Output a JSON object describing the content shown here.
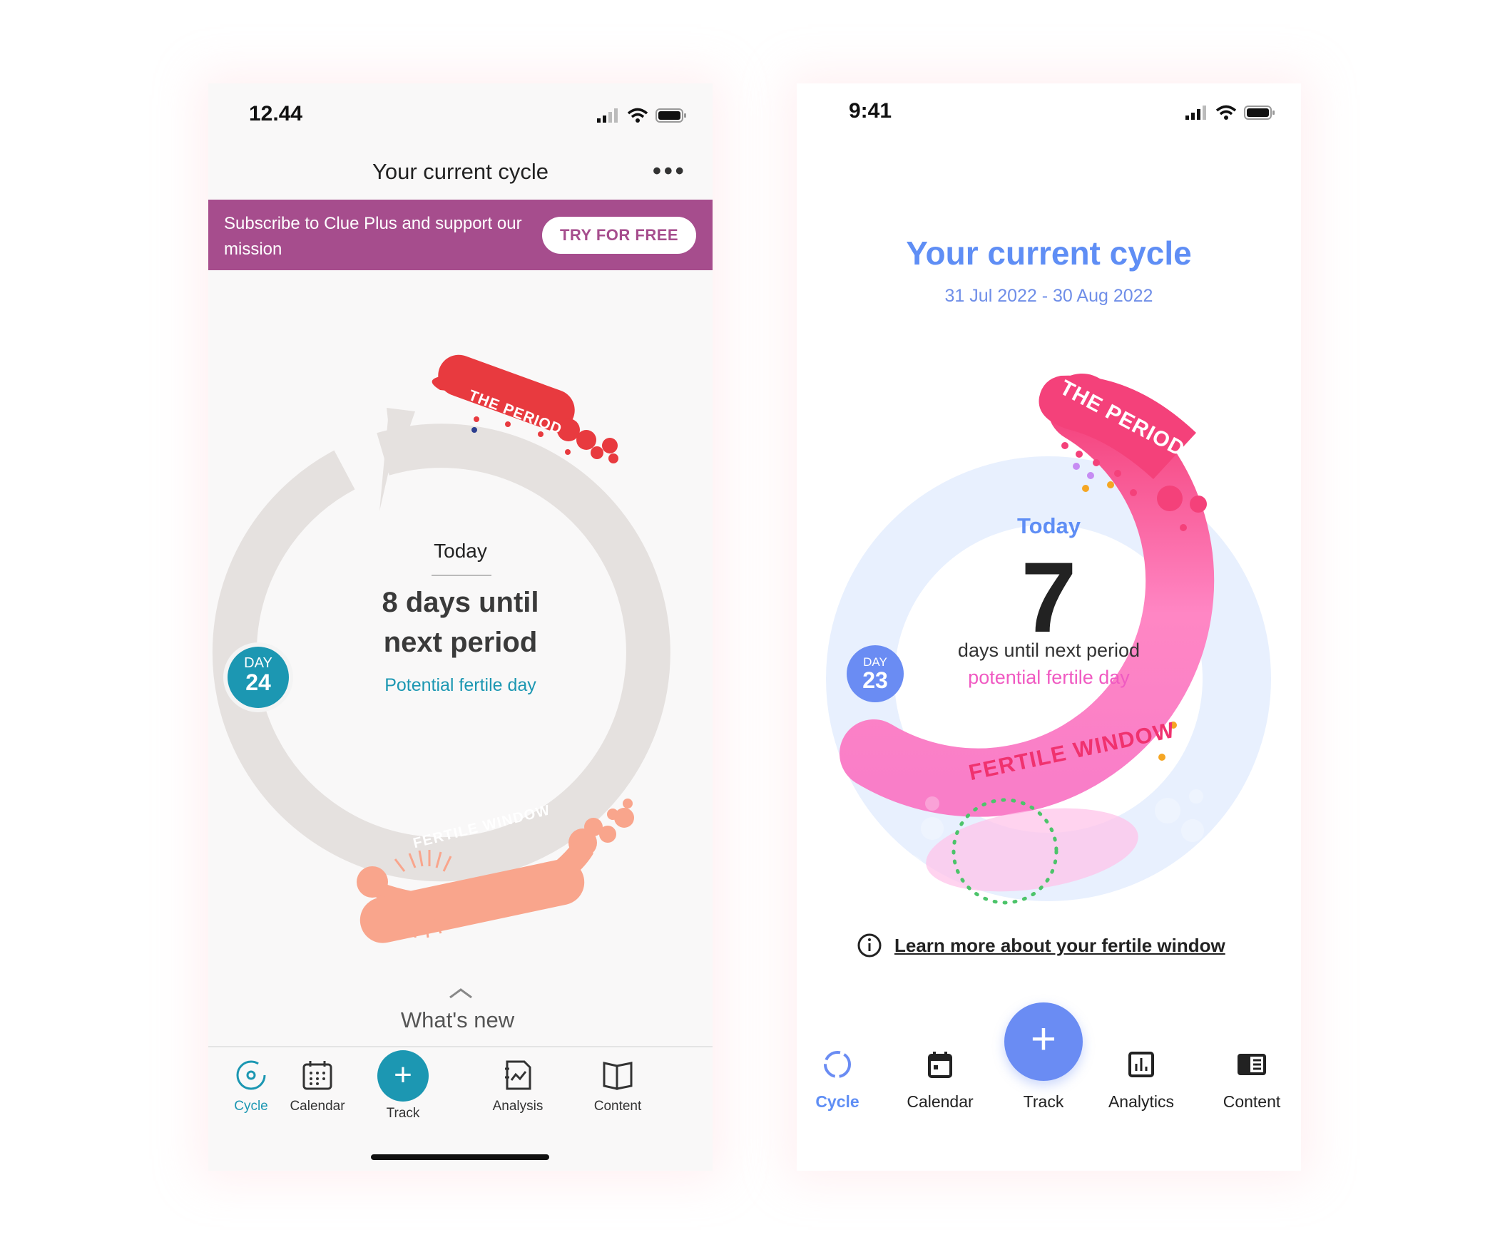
{
  "left_phone": {
    "status": {
      "time": "12.44"
    },
    "header": {
      "title": "Your current cycle",
      "more": "•••"
    },
    "banner": {
      "text": "Subscribe to Clue Plus and support our mission",
      "button": "TRY FOR FREE"
    },
    "ring": {
      "period_label": "THE PERIOD",
      "fertile_label": "FERTILE WINDOW",
      "day_label": "DAY",
      "day_number": "24"
    },
    "center": {
      "today": "Today",
      "main_line1": "8 days until",
      "main_line2": "next period",
      "fertile": "Potential fertile day"
    },
    "whats_new": "What's new",
    "nav": [
      {
        "label": "Cycle",
        "icon": "cycle-icon"
      },
      {
        "label": "Calendar",
        "icon": "calendar-icon"
      },
      {
        "label": "Track",
        "icon": "plus-icon"
      },
      {
        "label": "Analysis",
        "icon": "analysis-icon"
      },
      {
        "label": "Content",
        "icon": "book-icon"
      }
    ],
    "colors": {
      "accent": "#1c97b2",
      "banner": "#a64d8d",
      "period": "#e83a3f",
      "fertile": "#f9a58c"
    }
  },
  "right_phone": {
    "status": {
      "time": "9:41"
    },
    "title": "Your current  cycle",
    "dates": "31 Jul 2022 - 30 Aug 2022",
    "ring": {
      "period_label": "THE PERIOD",
      "fertile_label": "FERTILE WINDOW",
      "day_label": "DAY",
      "day_number": "23"
    },
    "center": {
      "today": "Today",
      "number": "7",
      "days_text": "days until next period",
      "fertile": "potential fertile day"
    },
    "learn_more": "Learn more about your fertile window",
    "nav": [
      {
        "label": "Cycle",
        "icon": "cycle-icon"
      },
      {
        "label": "Calendar",
        "icon": "calendar-icon"
      },
      {
        "label": "Track",
        "icon": "plus-icon"
      },
      {
        "label": "Analytics",
        "icon": "analytics-icon"
      },
      {
        "label": "Content",
        "icon": "content-icon"
      }
    ],
    "colors": {
      "accent": "#6a8cf3",
      "period": "#f4417a",
      "fertile": "#f97ec8"
    }
  }
}
